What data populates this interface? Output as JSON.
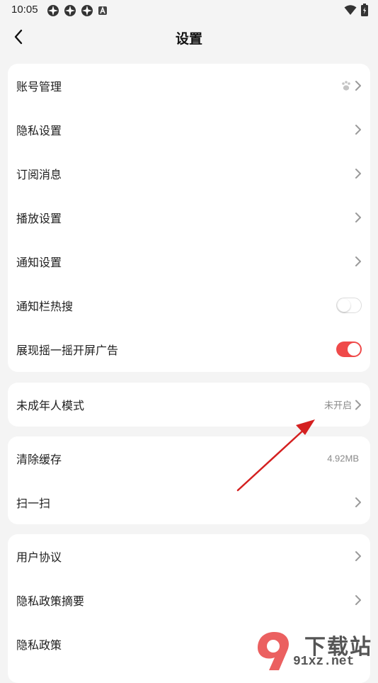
{
  "status_bar": {
    "time": "10:05"
  },
  "header": {
    "title": "设置"
  },
  "group1": [
    {
      "label": "账号管理"
    },
    {
      "label": "隐私设置"
    },
    {
      "label": "订阅消息"
    },
    {
      "label": "播放设置"
    },
    {
      "label": "通知设置"
    },
    {
      "label": "通知栏热搜",
      "toggle": false
    },
    {
      "label": "展现摇一摇开屏广告",
      "toggle": true
    }
  ],
  "group2": [
    {
      "label": "未成年人模式",
      "value": "未开启"
    }
  ],
  "group3": [
    {
      "label": "清除缓存",
      "value": "4.92MB"
    },
    {
      "label": "扫一扫"
    }
  ],
  "group4": [
    {
      "label": "用户协议"
    },
    {
      "label": "隐私政策摘要"
    },
    {
      "label": "隐私政策"
    }
  ],
  "watermark": {
    "top": "下载站",
    "bottom": "91xz.net"
  },
  "colors": {
    "accent": "#ef4a4a",
    "annotation_arrow": "#d42020",
    "background": "#f4f4f4"
  },
  "icons": {
    "account_row": "paw-icon"
  }
}
